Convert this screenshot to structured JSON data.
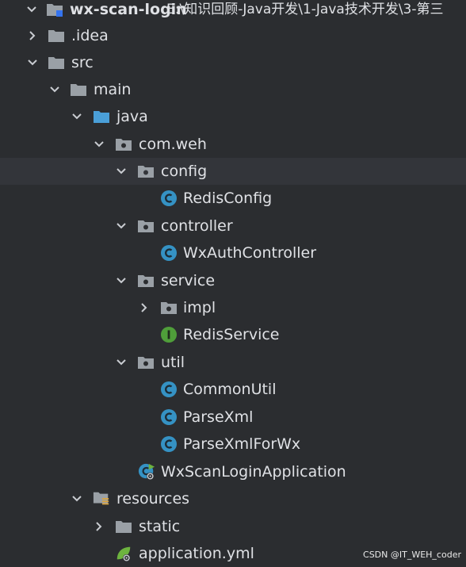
{
  "project": {
    "name": "wx-scan-login",
    "path": "E:\\知识回顾-Java开发\\1-Java技术开发\\3-第三"
  },
  "tree": [
    {
      "label": ".idea",
      "icon": "folder-icon",
      "expanded": false
    },
    {
      "label": "src",
      "icon": "folder-icon",
      "expanded": true
    },
    {
      "label": "main",
      "icon": "folder-icon",
      "expanded": true
    },
    {
      "label": "java",
      "icon": "source-folder-icon",
      "expanded": true
    },
    {
      "label": "com.weh",
      "icon": "package-icon",
      "expanded": true
    },
    {
      "label": "config",
      "icon": "package-icon",
      "expanded": true,
      "selected": true
    },
    {
      "label": "RedisConfig",
      "icon": "class-icon"
    },
    {
      "label": "controller",
      "icon": "package-icon",
      "expanded": true
    },
    {
      "label": "WxAuthController",
      "icon": "class-icon"
    },
    {
      "label": "service",
      "icon": "package-icon",
      "expanded": true
    },
    {
      "label": "impl",
      "icon": "package-icon",
      "expanded": false
    },
    {
      "label": "RedisService",
      "icon": "interface-icon"
    },
    {
      "label": "util",
      "icon": "package-icon",
      "expanded": true
    },
    {
      "label": "CommonUtil",
      "icon": "class-icon"
    },
    {
      "label": "ParseXml",
      "icon": "class-icon"
    },
    {
      "label": "ParseXmlForWx",
      "icon": "class-icon"
    },
    {
      "label": "WxScanLoginApplication",
      "icon": "spring-boot-app-icon"
    },
    {
      "label": "resources",
      "icon": "resources-folder-icon",
      "expanded": true
    },
    {
      "label": "static",
      "icon": "folder-icon",
      "expanded": false
    },
    {
      "label": "application.yml",
      "icon": "spring-yaml-icon"
    }
  ],
  "watermark": "CSDN @IT_WEH_coder",
  "colors": {
    "background": "#2b2d30",
    "selected_row": "#33353a",
    "folder": "#9aa0a6",
    "source_folder": "#4a9fd8",
    "class_badge": "#3592c4",
    "interface_badge": "#4f9e3a",
    "spring": "#6db33f"
  }
}
